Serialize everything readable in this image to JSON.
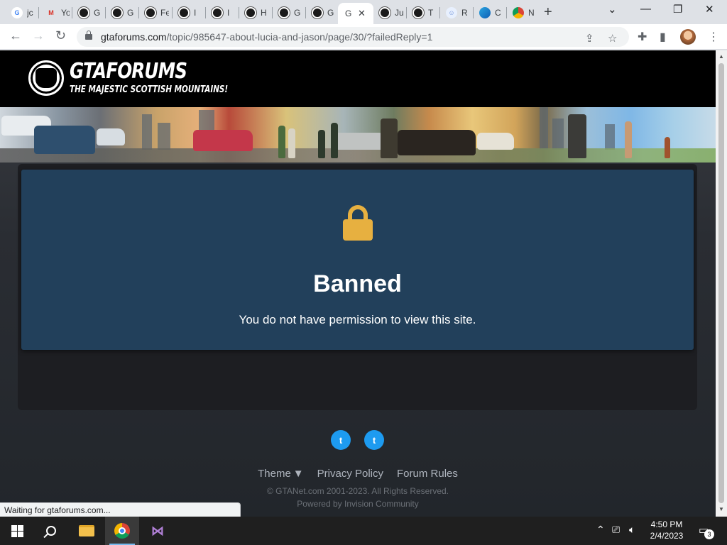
{
  "browser": {
    "tabs": [
      {
        "label": "jc",
        "favicon": "google-icon"
      },
      {
        "label": "Yo",
        "favicon": "gmail-icon"
      },
      {
        "label": "G",
        "favicon": "gtaforums-icon"
      },
      {
        "label": "G",
        "favicon": "gtaforums-icon"
      },
      {
        "label": "Fe",
        "favicon": "gtaforums-icon"
      },
      {
        "label": "I",
        "favicon": "gtaforums-icon"
      },
      {
        "label": "I",
        "favicon": "gtaforums-icon"
      },
      {
        "label": "H",
        "favicon": "gtaforums-icon"
      },
      {
        "label": "G",
        "favicon": "gtaforums-icon"
      },
      {
        "label": "G",
        "favicon": "gtaforums-icon"
      },
      {
        "label": "G",
        "favicon": "google-icon",
        "active": true
      },
      {
        "label": "Ju",
        "favicon": "gtaforums-icon"
      },
      {
        "label": "T",
        "favicon": "gtaforums-icon"
      },
      {
        "label": "R",
        "favicon": "reddit-icon"
      },
      {
        "label": "C",
        "favicon": "edge-icon"
      },
      {
        "label": "N",
        "favicon": "chrome-icon"
      }
    ],
    "new_tab": "+",
    "window_controls": {
      "list": "⌄",
      "minimize": "—",
      "restore": "❐",
      "close": "✕"
    },
    "url_host": "gtaforums.com",
    "url_path": "/topic/985647-about-lucia-and-jason/page/30/?failedReply=1",
    "nav": {
      "back": "←",
      "forward": "→",
      "reload": "↻"
    },
    "status_text": "Waiting for gtaforums.com..."
  },
  "site": {
    "logo_title": "GTAFORUMS",
    "logo_subtitle": "THE MAJESTIC SCOTTISH MOUNTAINS!",
    "ban_card": {
      "icon": "padlock-icon",
      "title": "Banned",
      "message": "You do not have permission to view this site."
    },
    "social": [
      {
        "name": "twitter-icon",
        "glyph": "t"
      },
      {
        "name": "twitter-icon",
        "glyph": "t"
      }
    ],
    "footer_links": [
      "Theme",
      "Privacy Policy",
      "Forum Rules"
    ],
    "copyright": "© GTANet.com 2001-2023. All Rights Reserved.",
    "powered": "Powered by Invision Community"
  },
  "taskbar": {
    "time": "4:50 PM",
    "date": "2/4/2023",
    "notification_count": "3",
    "colors": {
      "accent": "#76b9ed",
      "card": "#22405b",
      "lock": "#e7b040"
    }
  }
}
